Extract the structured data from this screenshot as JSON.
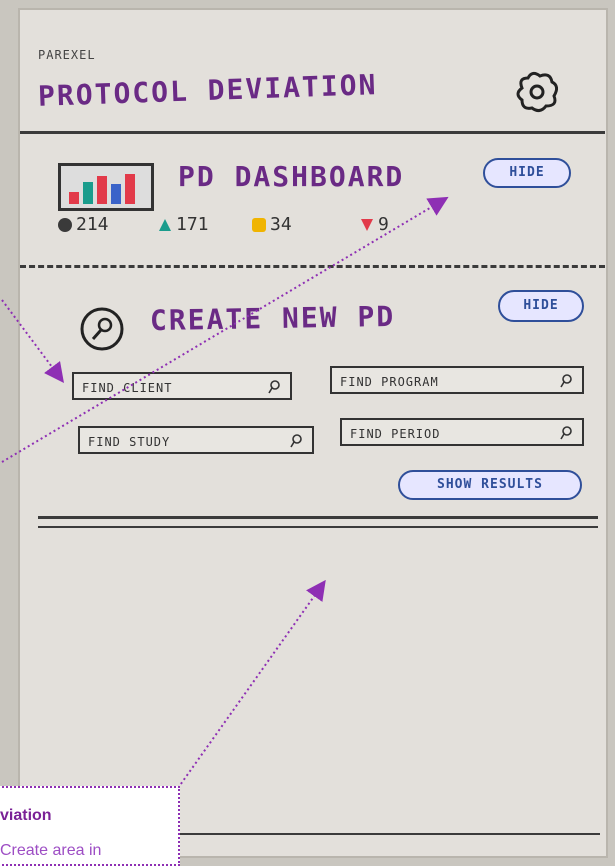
{
  "header": {
    "brand": "PAREXEL",
    "title": "PROTOCOL DEVIATION",
    "settings_icon": "gear-icon"
  },
  "dashboard": {
    "title": "PD DASHBOARD",
    "hide_label": "HIDE",
    "stats": [
      {
        "icon": "circle-icon",
        "color": "#3a3a3a",
        "value": "214"
      },
      {
        "icon": "triangle-up-icon",
        "color": "#1a9c8c",
        "value": "171"
      },
      {
        "icon": "square-icon",
        "color": "#f0b400",
        "value": "34"
      },
      {
        "icon": "triangle-down-icon",
        "color": "#e23a4a",
        "value": "9"
      }
    ]
  },
  "create": {
    "title": "CREATE NEW PD",
    "hide_label": "HIDE",
    "fields": {
      "find_client": "FIND CLIENT",
      "find_program": "FIND PROGRAM",
      "find_study": "FIND STUDY",
      "find_period": "FIND PERIOD"
    },
    "show_results": "SHOW RESULTS"
  },
  "annotation": {
    "title": "viation",
    "text": "Create area in"
  },
  "colors": {
    "paper": "#e3e0db",
    "sketch_purple": "#6a2a85",
    "pill_blue": "#2f4f9a",
    "annotation": "#8e2fb4"
  }
}
